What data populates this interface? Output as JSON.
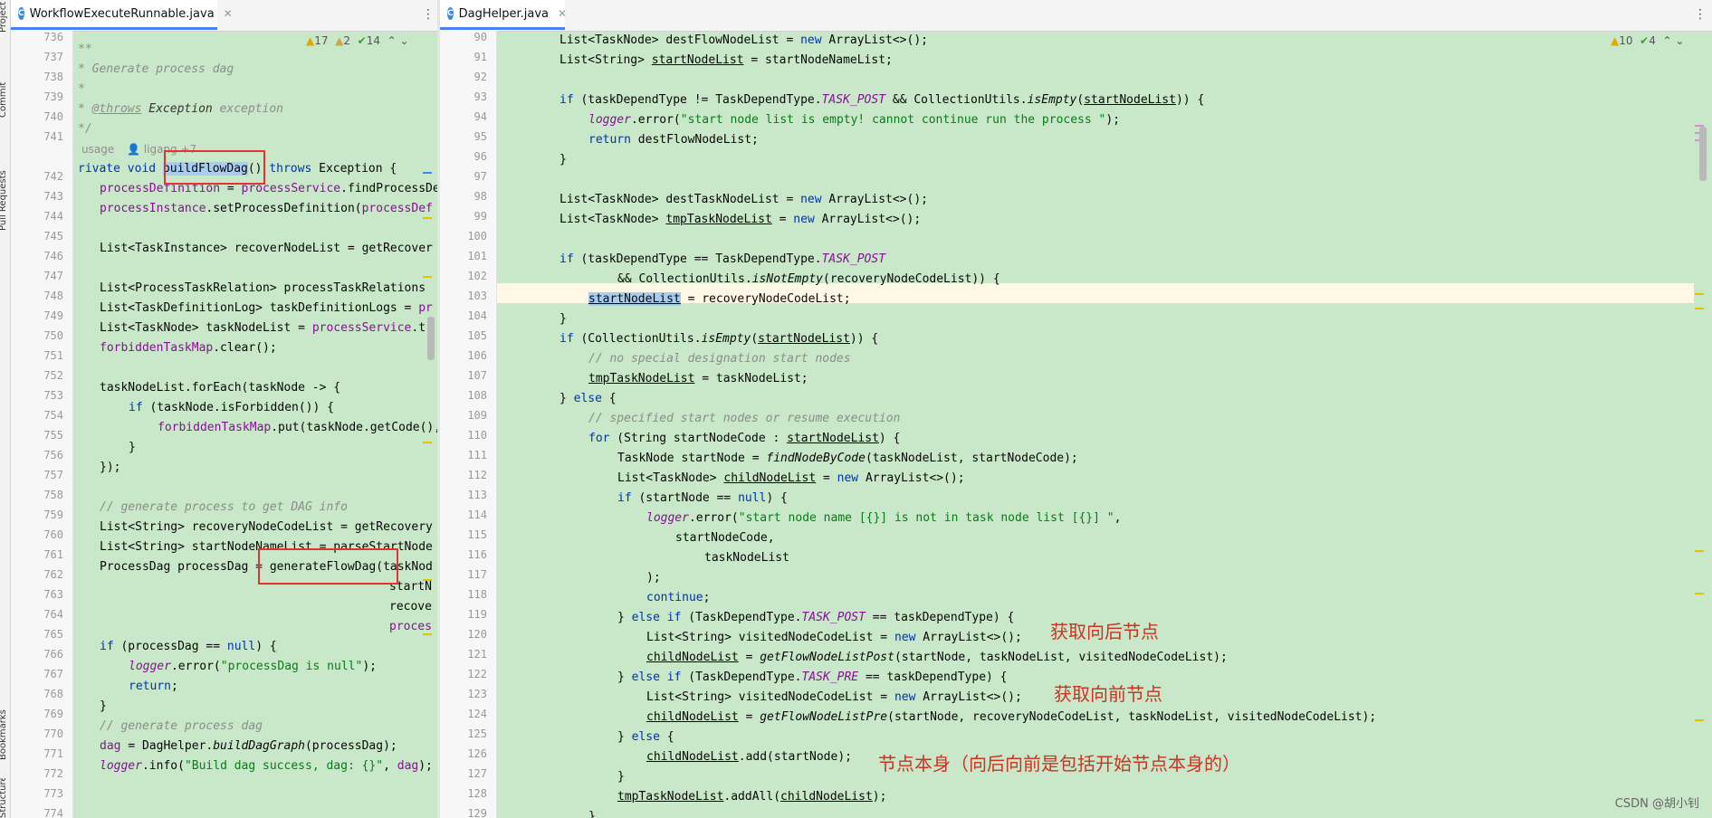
{
  "tool_strip": [
    "Project",
    "Commit",
    "Pull Requests",
    "Bookmarks",
    "Structure"
  ],
  "left_editor": {
    "tab_label": "WorkflowExecuteRunnable.java",
    "tab_icon": "C",
    "status": {
      "warnings": "17",
      "weak_warnings": "2",
      "typos": "14"
    },
    "usage_hint": "usage",
    "author_hint": "ligang +7",
    "line_numbers": [
      "736",
      "737",
      "738",
      "739",
      "740",
      "741",
      "742",
      "743",
      "744",
      "745",
      "746",
      "747",
      "748",
      "749",
      "750",
      "751",
      "752",
      "753",
      "754",
      "755",
      "756",
      "757",
      "758",
      "759",
      "760",
      "761",
      "762",
      "763",
      "764",
      "765",
      "766",
      "767",
      "768",
      "769",
      "770",
      "771",
      "772",
      "773",
      "774"
    ]
  },
  "right_editor": {
    "tab_label": "DagHelper.java",
    "tab_icon": "C",
    "status": {
      "warnings": "10",
      "typos": "4"
    },
    "line_numbers": [
      "90",
      "91",
      "92",
      "93",
      "94",
      "95",
      "96",
      "97",
      "98",
      "99",
      "100",
      "101",
      "102",
      "103",
      "104",
      "105",
      "106",
      "107",
      "108",
      "109",
      "110",
      "111",
      "112",
      "113",
      "114",
      "115",
      "116",
      "117",
      "118",
      "119",
      "120",
      "121",
      "122",
      "123",
      "124",
      "125",
      "126",
      "127",
      "128",
      "129"
    ]
  },
  "annotations": {
    "next_nodes": "获取向后节点",
    "prev_nodes": "获取向前节点",
    "node_self": "节点本身（向后向前是包括开始节点本身的）"
  },
  "watermark": "CSDN @胡小钊"
}
